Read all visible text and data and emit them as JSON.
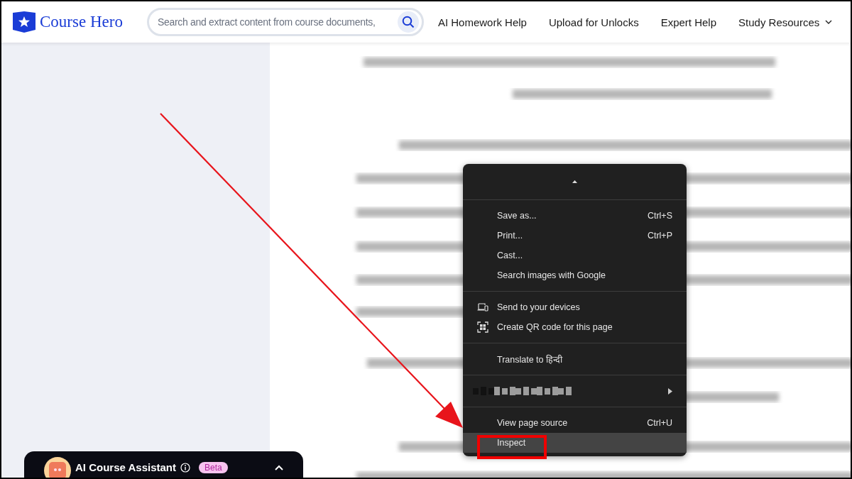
{
  "header": {
    "logo": "Course Hero",
    "search": {
      "placeholder": "Search and extract content from course documents,"
    },
    "nav": [
      {
        "label": "AI Homework Help",
        "dropdown": false
      },
      {
        "label": "Upload for Unlocks",
        "dropdown": false
      },
      {
        "label": "Expert Help",
        "dropdown": false
      },
      {
        "label": "Study Resources",
        "dropdown": true
      }
    ]
  },
  "context_menu": {
    "sections": [
      [
        {
          "kind": "scroll-up"
        }
      ],
      [
        {
          "kind": "plain",
          "label": "Save as...",
          "shortcut": "Ctrl+S",
          "selected": false
        },
        {
          "kind": "plain",
          "label": "Print...",
          "shortcut": "Ctrl+P",
          "selected": false
        },
        {
          "kind": "plain",
          "label": "Cast...",
          "selected": false
        },
        {
          "kind": "plain",
          "label": "Search images with Google",
          "selected": false
        }
      ],
      [
        {
          "kind": "devices",
          "label": "Send to your devices",
          "selected": false
        },
        {
          "kind": "qr",
          "label": "Create QR code for this page",
          "selected": false
        }
      ],
      [
        {
          "kind": "plain",
          "label": "Translate to हिन्दी",
          "selected": false
        }
      ],
      [
        {
          "kind": "submenu",
          "selected": false
        }
      ],
      [
        {
          "kind": "plain",
          "label": "View page source",
          "shortcut": "Ctrl+U",
          "selected": false
        },
        {
          "kind": "plain",
          "label": "Inspect",
          "selected": true,
          "highlighted": true
        }
      ]
    ]
  },
  "assistant": {
    "title": "AI Course Assistant",
    "badge": "Beta",
    "expanded": false
  }
}
